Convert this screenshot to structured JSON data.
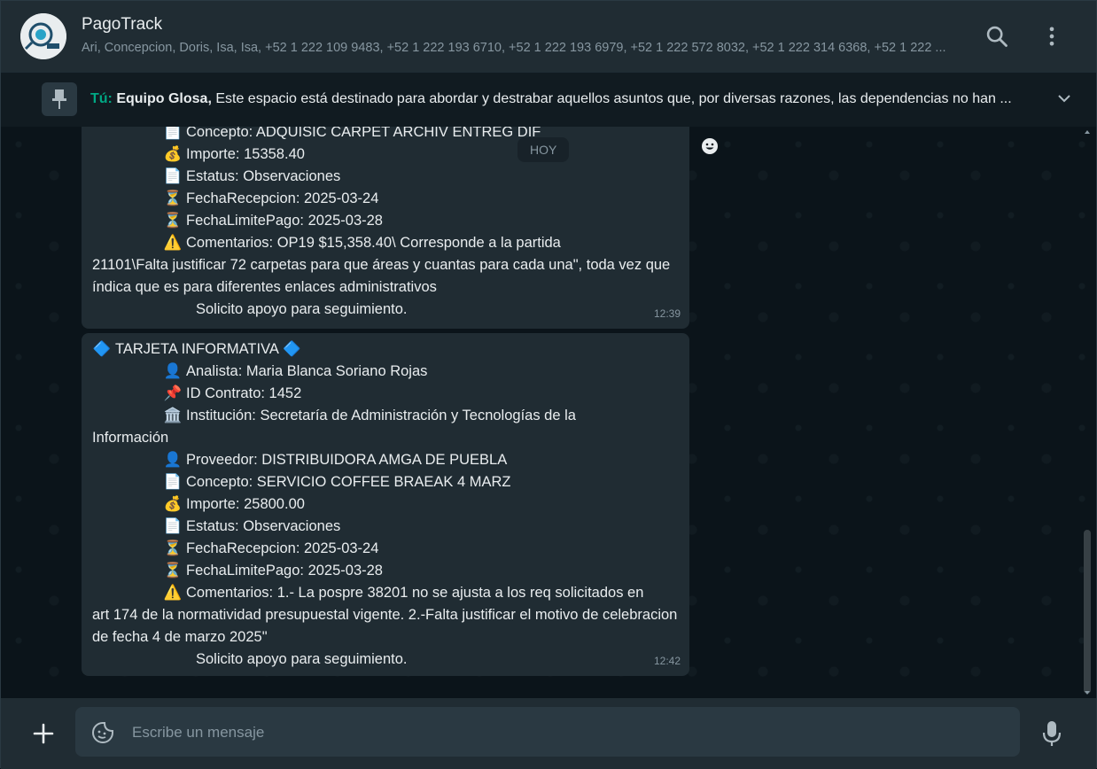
{
  "header": {
    "title": "PagoTrack",
    "members": "Ari, Concepcion, Doris, Isa, Isa, +52 1 222 109 9483, +52 1 222 193 6710, +52 1 222 193 6979, +52 1 222 572 8032, +52 1 222 314 6368, +52 1 222 ...",
    "avatar_text": "PagoTrack"
  },
  "pinned": {
    "you": "Tú:",
    "group": "Equipo Glosa,",
    "text": " Este espacio está destinado para abordar y destrabar aquellos asuntos que, por diversas razones, las dependencias no han ..."
  },
  "date_chip": "HOY",
  "messages": [
    {
      "concepto": "Concepto: ADQUISIC CARPET ARCHIV ENTREG DIF",
      "importe": "Importe: 15358.40",
      "estatus": "Estatus: Observaciones",
      "fecha_recepcion": "FechaRecepcion: 2025-03-24",
      "fecha_limite": "FechaLimitePago: 2025-03-28",
      "comentarios_1": "Comentarios:  OP19   $15,358.40\\ Corresponde a la partida",
      "comentarios_2": "21101\\Falta justificar  72 carpetas  para que áreas y cuantas para cada una\", toda vez que índica que es para diferentes enlaces administrativos",
      "solicito": "Solicito apoyo para seguimiento.",
      "time": "12:39"
    },
    {
      "heading": "TARJETA INFORMATIVA",
      "analista": "Analista: Maria Blanca Soriano Rojas",
      "id_contrato": "ID Contrato: 1452",
      "institucion_1": "Institución: Secretaría de Administración y Tecnologías de la",
      "institucion_2": "Información",
      "proveedor": "Proveedor: DISTRIBUIDORA AMGA DE PUEBLA",
      "concepto": "Concepto: SERVICIO COFFEE BRAEAK 4 MARZ",
      "importe": "Importe: 25800.00",
      "estatus": "Estatus: Observaciones",
      "fecha_recepcion": "FechaRecepcion: 2025-03-24",
      "fecha_limite": "FechaLimitePago: 2025-03-28",
      "comentarios_1": "Comentarios: 1.- La pospre 38201 no se ajusta a los req solicitados en",
      "comentarios_2": "art 174 de la normatividad presupuestal vigente.  2.-Falta justificar el motivo de celebracion de fecha 4 de marzo 2025\"",
      "solicito": "Solicito apoyo para seguimiento.",
      "time": "12:42"
    }
  ],
  "composer": {
    "placeholder": "Escribe un mensaje"
  },
  "emojis": {
    "doc": "📄",
    "money": "💰",
    "hourglass": "⏳",
    "warning": "⚠️",
    "person": "👤",
    "pin": "📌",
    "bank": "🏛️",
    "diamond": "🔷"
  },
  "colors": {
    "accent": "#00a884",
    "bubble": "#202c33",
    "background": "#0b141a"
  }
}
